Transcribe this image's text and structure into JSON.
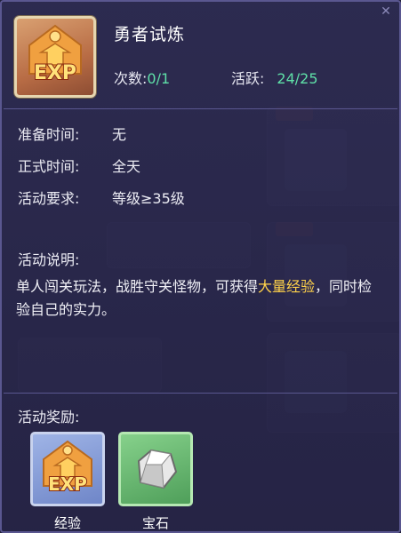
{
  "activity": {
    "title": "勇者试炼",
    "count_label": "次数:",
    "count_value": "0/1",
    "active_label": "活跃:",
    "active_value": "24/25"
  },
  "details": {
    "prep_label": "准备时间:",
    "prep_value": "无",
    "formal_label": "正式时间:",
    "formal_value": "全天",
    "req_label": "活动要求:",
    "req_value": "等级≥35级"
  },
  "description": {
    "label": "活动说明:",
    "text_before": "单人闯关玩法，战胜守关怪物，可获得",
    "highlight": "大量经验",
    "text_after": "，同时检验自己的实力。"
  },
  "rewards": {
    "label": "活动奖励:",
    "items": [
      {
        "name": "经验",
        "icon": "exp-icon"
      },
      {
        "name": "宝石",
        "icon": "gem-icon"
      }
    ]
  },
  "header_icon_text": "EXP",
  "colors": {
    "count": "#5fe0a8",
    "highlight": "#ffd24a",
    "panel": "#2e2c52"
  }
}
